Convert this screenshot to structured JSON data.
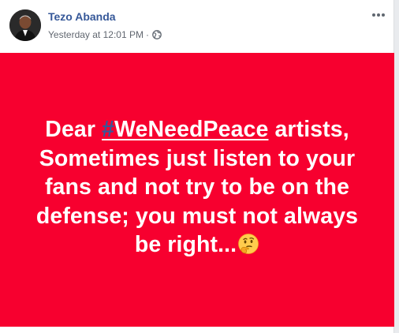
{
  "post": {
    "author": "Tezo Abanda",
    "timestamp": "Yesterday at 12:01 PM",
    "separator": "·",
    "privacy_icon": "globe-icon",
    "more_icon": "more-options-icon",
    "background_color": "#f7002f",
    "text": {
      "before_hashtag": "Dear ",
      "hashtag_symbol": "#",
      "hashtag_word": "WeNeedPeace",
      "line1_rest": " artists,",
      "line2": "Sometimes just listen to your",
      "line3": "fans and not try to be on the",
      "line4": "defense; you must not always",
      "line5": "be right...",
      "emoji": "thinking-face-icon"
    }
  }
}
